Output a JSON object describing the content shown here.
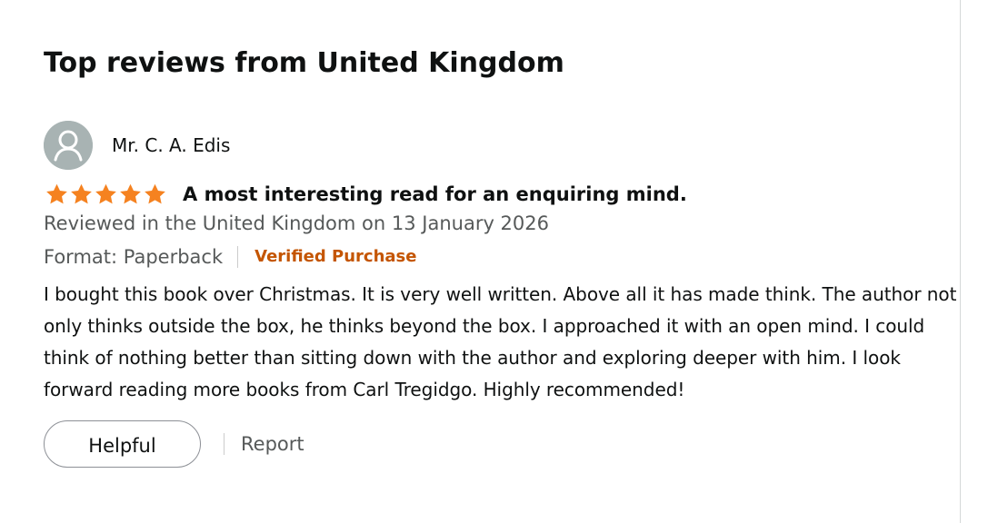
{
  "section": {
    "title": "Top reviews from United Kingdom"
  },
  "review": {
    "reviewer": {
      "name": "Mr. C. A. Edis",
      "avatar_icon": "default-profile-icon"
    },
    "rating": {
      "stars": 5,
      "max_stars": 5,
      "star_icon": "star-icon",
      "star_color": "#f58220"
    },
    "title": "A most interesting read for an enquiring mind.",
    "date_line": "Reviewed in the United Kingdom on 13 January 2026",
    "format": "Format: Paperback",
    "verified_badge": "Verified Purchase",
    "body": "I bought this book over Christmas. It is very well written. Above all it has made think. The author not only thinks outside the box, he thinks beyond the box. I approached it with an open mind. I could think of nothing better than sitting down with the author and exploring deeper with him. I look forward reading more books from Carl Tregidgo. Highly recommended!",
    "actions": {
      "helpful_label": "Helpful",
      "report_label": "Report"
    }
  },
  "colors": {
    "verified": "#c45500",
    "secondary_text": "#565959",
    "primary_text": "#0f1111",
    "star": "#f58220",
    "avatar_background": "#a8b3b3"
  }
}
